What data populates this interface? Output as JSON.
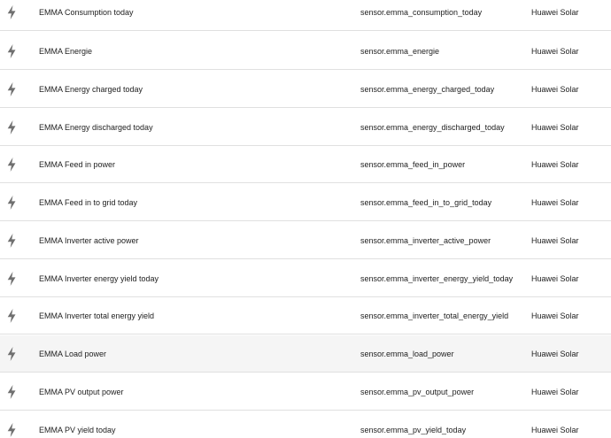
{
  "entities": [
    {
      "name": "EMMA Consumption today",
      "entity_id": "sensor.emma_consumption_today",
      "integration": "Huawei Solar",
      "icon": "flash-icon"
    },
    {
      "name": "EMMA Energie",
      "entity_id": "sensor.emma_energie",
      "integration": "Huawei Solar",
      "icon": "flash-icon"
    },
    {
      "name": "EMMA Energy charged today",
      "entity_id": "sensor.emma_energy_charged_today",
      "integration": "Huawei Solar",
      "icon": "flash-icon"
    },
    {
      "name": "EMMA Energy discharged today",
      "entity_id": "sensor.emma_energy_discharged_today",
      "integration": "Huawei Solar",
      "icon": "flash-icon"
    },
    {
      "name": "EMMA Feed in power",
      "entity_id": "sensor.emma_feed_in_power",
      "integration": "Huawei Solar",
      "icon": "flash-icon"
    },
    {
      "name": "EMMA Feed in to grid today",
      "entity_id": "sensor.emma_feed_in_to_grid_today",
      "integration": "Huawei Solar",
      "icon": "flash-icon"
    },
    {
      "name": "EMMA Inverter active power",
      "entity_id": "sensor.emma_inverter_active_power",
      "integration": "Huawei Solar",
      "icon": "flash-icon"
    },
    {
      "name": "EMMA Inverter energy yield today",
      "entity_id": "sensor.emma_inverter_energy_yield_today",
      "integration": "Huawei Solar",
      "icon": "flash-icon"
    },
    {
      "name": "EMMA Inverter total energy yield",
      "entity_id": "sensor.emma_inverter_total_energy_yield",
      "integration": "Huawei Solar",
      "icon": "flash-icon"
    },
    {
      "name": "EMMA Load power",
      "entity_id": "sensor.emma_load_power",
      "integration": "Huawei Solar",
      "icon": "flash-icon"
    },
    {
      "name": "EMMA PV output power",
      "entity_id": "sensor.emma_pv_output_power",
      "integration": "Huawei Solar",
      "icon": "flash-icon"
    },
    {
      "name": "EMMA PV yield today",
      "entity_id": "sensor.emma_pv_yield_today",
      "integration": "Huawei Solar",
      "icon": "flash-icon"
    }
  ],
  "colors": {
    "icon": "#6f6f6f",
    "divider": "#e0e0e0",
    "hover_row": "#f5f5f5",
    "text": "#212121"
  },
  "highlighted_row": 9
}
